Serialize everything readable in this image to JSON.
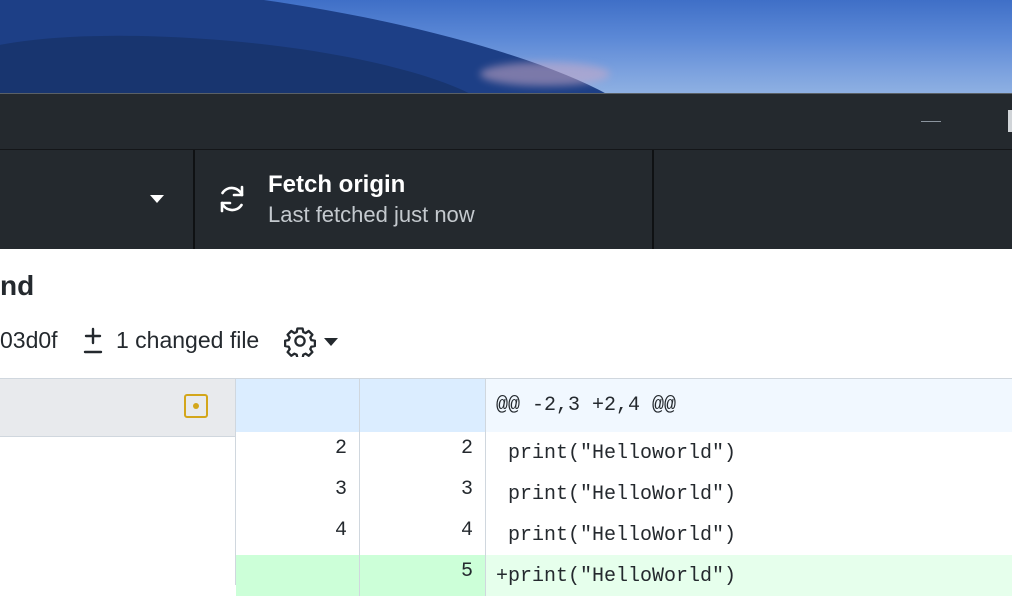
{
  "window": {
    "minimize_label": "—"
  },
  "toolbar": {
    "fetch": {
      "title": "Fetch origin",
      "subtitle": "Last fetched just now"
    }
  },
  "commit": {
    "title": "nd",
    "sha": "03d0f",
    "changed_files": "1 changed file"
  },
  "colors": {
    "toolbar_bg": "#24292e",
    "hunk_bg": "#f1f8ff",
    "added_bg": "#e6ffec",
    "modified_icon": "#d3a61b"
  },
  "diff": {
    "hunk_header": "@@ -2,3 +2,4 @@",
    "lines": [
      {
        "old": "2",
        "new": "2",
        "text": " print(\"Helloworld\")"
      },
      {
        "old": "3",
        "new": "3",
        "text": " print(\"HelloWorld\")"
      },
      {
        "old": "4",
        "new": "4",
        "text": " print(\"HelloWorld\")"
      },
      {
        "old": "",
        "new": "5",
        "text": "+print(\"HelloWorld\")"
      }
    ]
  }
}
